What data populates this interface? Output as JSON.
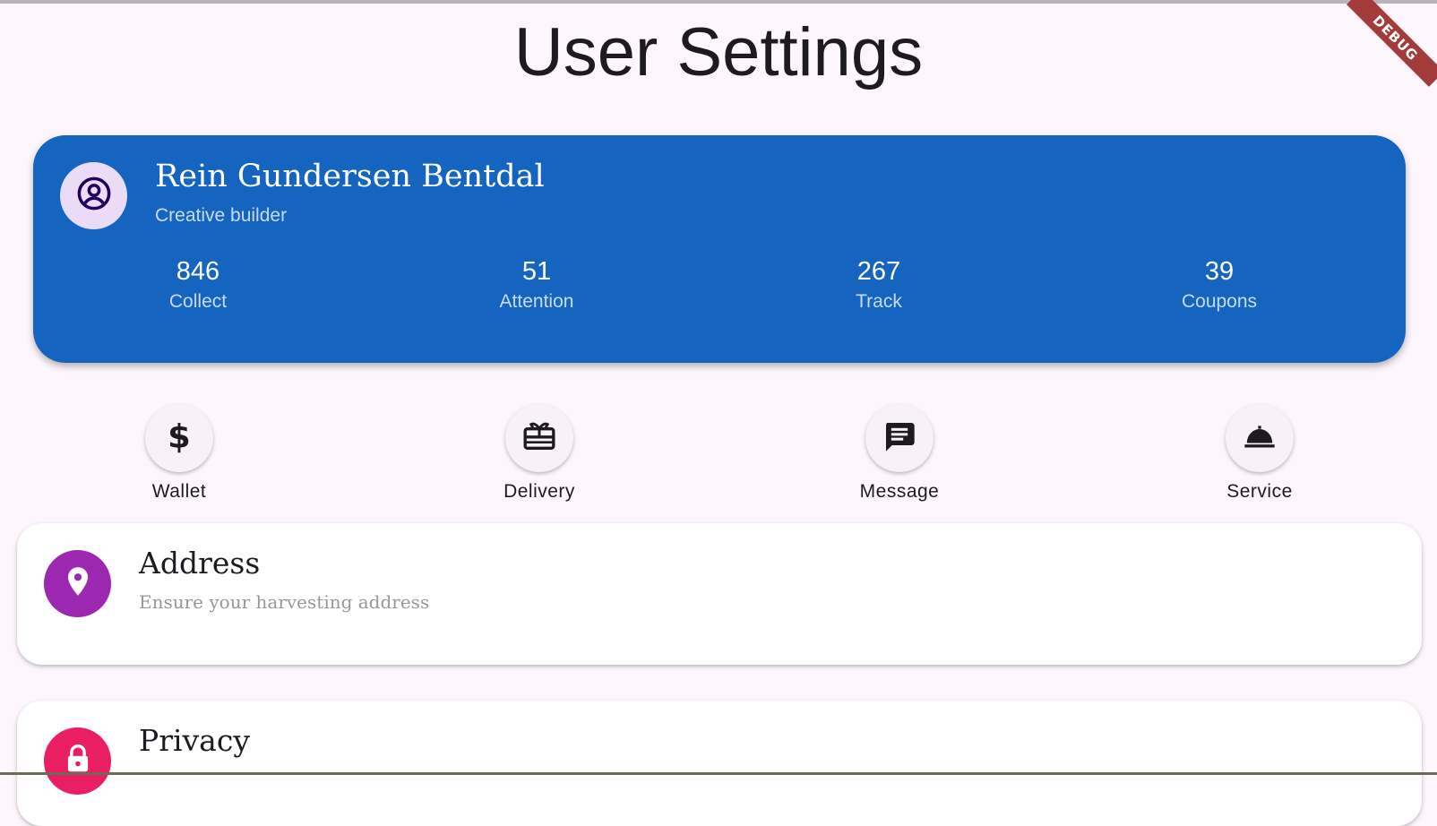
{
  "page": {
    "title": "User Settings",
    "debug_banner": "DEBUG"
  },
  "profile": {
    "avatar_icon": "account-circle-icon",
    "name": "Rein Gundersen Bentdal",
    "role": "Creative builder",
    "card_color": "#1565c0",
    "stats": [
      {
        "value": "846",
        "label": "Collect"
      },
      {
        "value": "51",
        "label": "Attention"
      },
      {
        "value": "267",
        "label": "Track"
      },
      {
        "value": "39",
        "label": "Coupons"
      }
    ]
  },
  "actions": [
    {
      "label": "Wallet",
      "icon": "dollar-icon"
    },
    {
      "label": "Delivery",
      "icon": "gift-card-icon"
    },
    {
      "label": "Message",
      "icon": "message-icon"
    },
    {
      "label": "Service",
      "icon": "room-service-icon"
    }
  ],
  "settings": [
    {
      "title": "Address",
      "subtitle": "Ensure your harvesting address",
      "icon": "location-pin-icon",
      "color": "#9c27b0"
    },
    {
      "title": "Privacy",
      "subtitle": "",
      "icon": "lock-icon",
      "color": "#e91e63"
    }
  ]
}
